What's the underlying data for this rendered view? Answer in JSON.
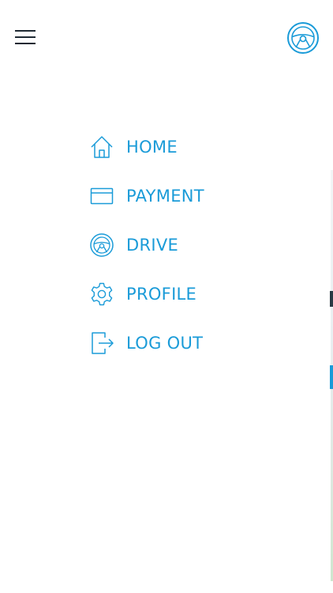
{
  "header": {
    "menu_icon": "hamburger-icon",
    "drive_icon": "steering-wheel-icon"
  },
  "menu": {
    "items": [
      {
        "label": "HOME",
        "icon": "house-icon"
      },
      {
        "label": "PAYMENT",
        "icon": "credit-card-icon"
      },
      {
        "label": "DRIVE",
        "icon": "steering-wheel-icon"
      },
      {
        "label": "PROFILE",
        "icon": "gear-icon"
      },
      {
        "label": "LOG OUT",
        "icon": "logout-icon"
      }
    ]
  },
  "colors": {
    "accent": "#1a9bd8",
    "icon_dark": "#1f2a33",
    "background": "#ffffff"
  }
}
